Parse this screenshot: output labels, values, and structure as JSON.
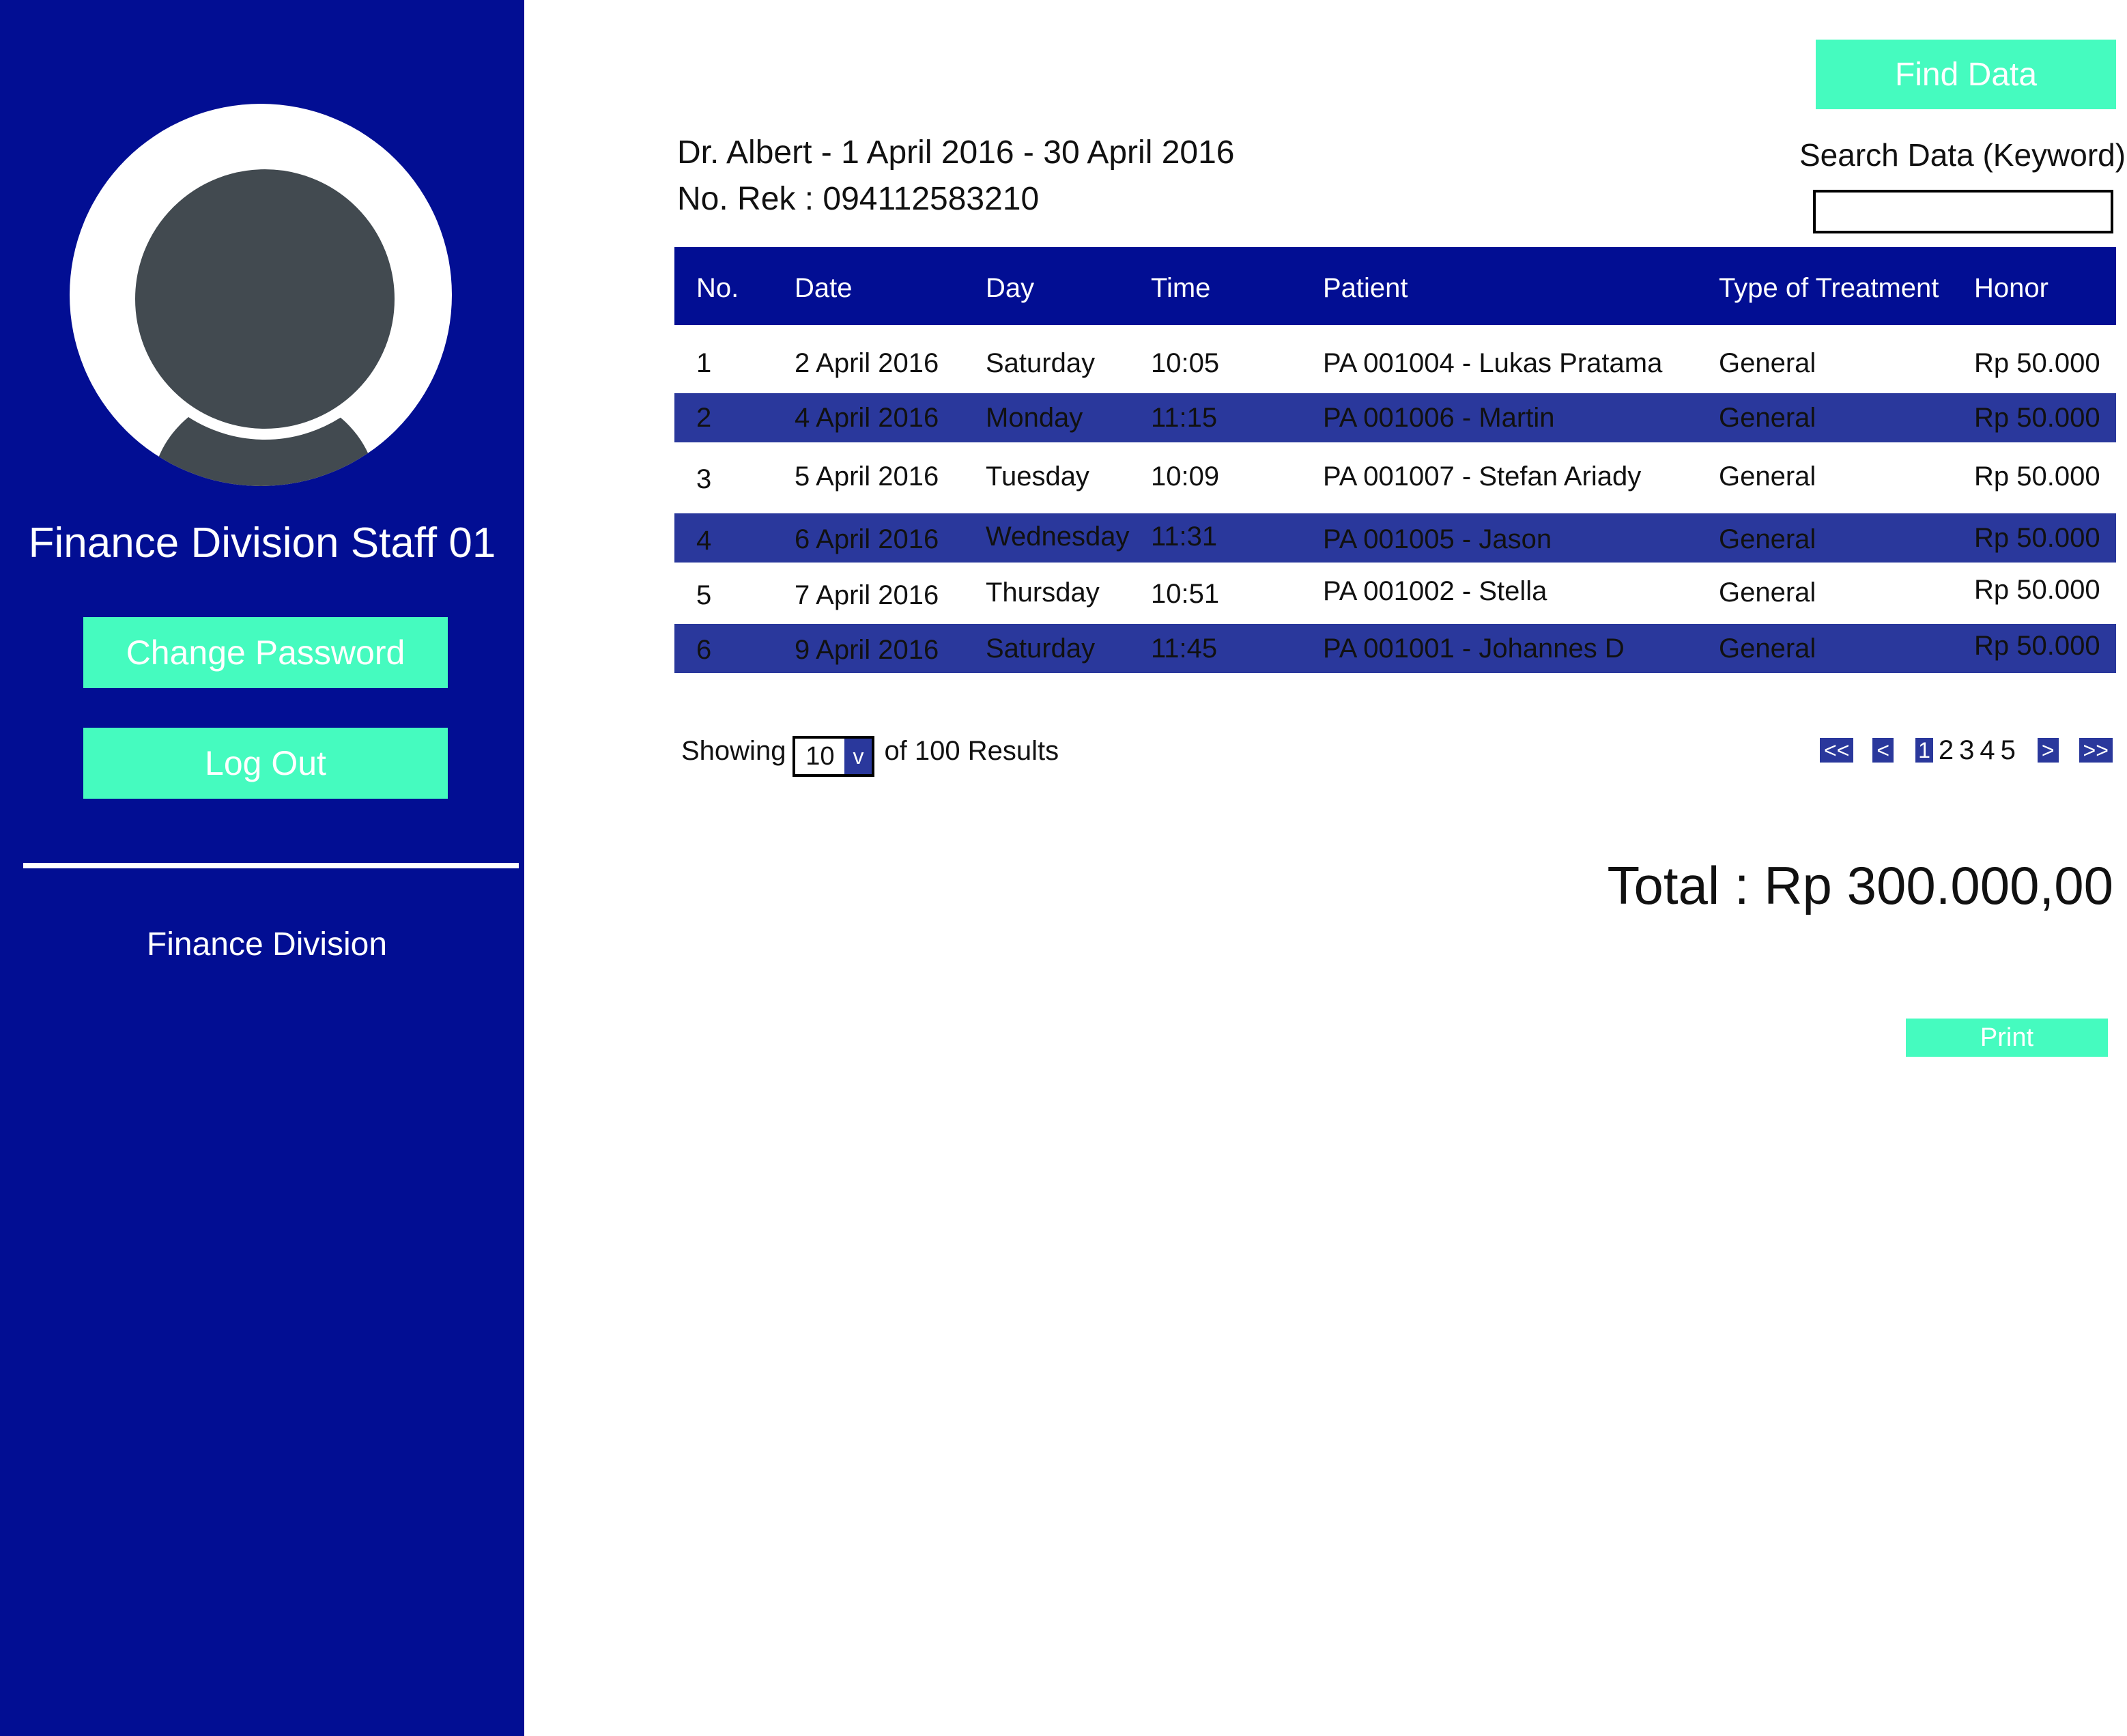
{
  "sidebar": {
    "staff_name": "Finance Division Staff 01",
    "change_password": "Change Password",
    "log_out": "Log Out",
    "division": "Finance Division"
  },
  "header": {
    "find_data": "Find Data",
    "search_label": "Search Data (Keyword)",
    "search_value": "",
    "title": "Dr. Albert - 1 April 2016 - 30 April 2016",
    "rek": "No. Rek : 094112583210"
  },
  "table": {
    "columns": [
      "No.",
      "Date",
      "Day",
      "Time",
      "Patient",
      "Type of Treatment",
      "Honor"
    ],
    "rows": [
      [
        "1",
        "2 April 2016",
        "Saturday",
        "10:05",
        "PA 001004 - Lukas Pratama",
        "General",
        "Rp 50.000"
      ],
      [
        "2",
        "4 April 2016",
        "Monday",
        "11:15",
        "PA 001006 - Martin",
        "General",
        "Rp 50.000"
      ],
      [
        "3",
        "5 April 2016",
        "Tuesday",
        "10:09",
        "PA 001007 - Stefan Ariady",
        "General",
        "Rp 50.000"
      ],
      [
        "4",
        "6 April 2016",
        "Wednesday",
        "11:31",
        "PA 001005 - Jason",
        "General",
        "Rp 50.000"
      ],
      [
        "5",
        "7 April 2016",
        "Thursday",
        "10:51",
        "PA 001002 - Stella",
        "General",
        "Rp 50.000"
      ],
      [
        "6",
        "9 April 2016",
        "Saturday",
        "11:45",
        "PA 001001 - Johannes D",
        "General",
        "Rp 50.000"
      ]
    ]
  },
  "pagination": {
    "showing_label": "Showing",
    "per_page": "10",
    "dropdown_arrow": "v",
    "results_label": "of 100 Results",
    "first": "<<",
    "prev": "<",
    "pages": [
      "1",
      "2",
      "3",
      "4",
      "5"
    ],
    "next": ">",
    "last": ">>"
  },
  "footer": {
    "total": "Total : Rp 300.000,00",
    "print": "Print"
  },
  "colors": {
    "sidebar": "#020e93",
    "header_row": "#020e93",
    "alt_row": "#2a389c",
    "accent_button": "#45fbbf",
    "avatar": "#424a50"
  }
}
